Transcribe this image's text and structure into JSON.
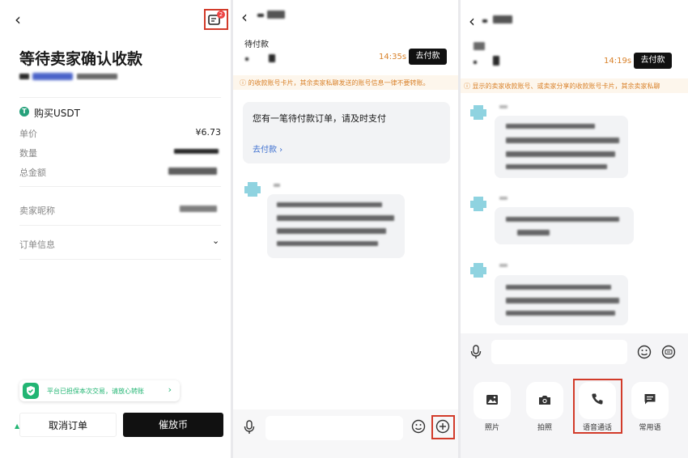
{
  "panel1": {
    "title": "等待卖家确认收款",
    "badge_count": "2",
    "coin_label": "购买USDT",
    "rows": [
      {
        "label": "单价",
        "value": "¥6.73"
      },
      {
        "label": "数量",
        "value": ""
      },
      {
        "label": "总金额",
        "value": ""
      },
      {
        "label": "卖家昵称",
        "value": ""
      }
    ],
    "order_info_label": "订单信息",
    "protect_text": "平台已担保本次交易，请放心转账",
    "cancel_label": "取消订单",
    "release_label": "催放币",
    "accent_color": "#22b573"
  },
  "panel2": {
    "status_label": "待付款",
    "timer": "14:35s",
    "pay_button": "去付款",
    "warning": "的收款账号卡片，其余卖家私聊发送的账号信息一律不要转账。",
    "card_text": "您有一笔待付款订单，请及时支付",
    "card_link": "去付款"
  },
  "panel3": {
    "timer": "14:19s",
    "pay_button": "去付款",
    "warning": "显示的卖家收款账号、或卖家分享的收款账号卡片，其余卖家私聊",
    "tools": [
      {
        "label": "照片",
        "icon": "image-icon"
      },
      {
        "label": "拍照",
        "icon": "camera-icon"
      },
      {
        "label": "语音通话",
        "icon": "phone-icon"
      },
      {
        "label": "常用语",
        "icon": "message-icon"
      }
    ]
  },
  "colors": {
    "highlight": "#d23b2a",
    "warning": "#d9822b",
    "avatar": "#8fd3e0"
  }
}
